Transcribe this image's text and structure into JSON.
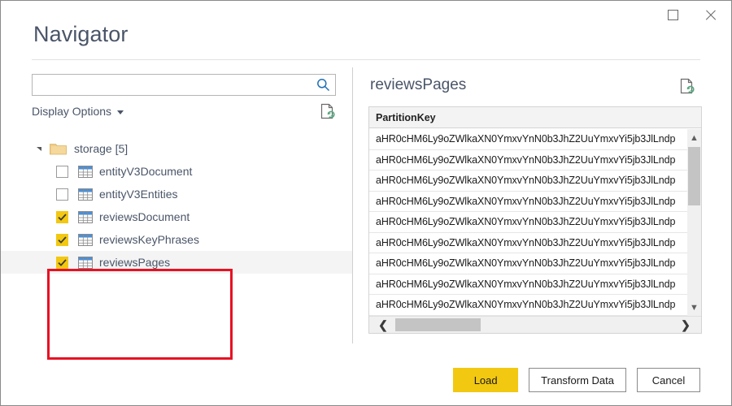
{
  "window": {
    "title": "Navigator",
    "maximize_label": "Maximize",
    "close_label": "Close"
  },
  "search": {
    "value": "",
    "placeholder": "",
    "icon": "search-icon"
  },
  "display_options": {
    "label": "Display Options",
    "caret_icon": "chevron-down-icon",
    "refresh_icon": "refresh-page-icon"
  },
  "tree": {
    "root": {
      "label": "storage [5]",
      "count": "[5]",
      "expanded": true,
      "folder_icon": "folder-icon",
      "expander_icon": "expander-triangle-icon"
    },
    "items": [
      {
        "label": "entityV3Document",
        "checked": false,
        "selected": false,
        "icon": "table-icon"
      },
      {
        "label": "entityV3Entities",
        "checked": false,
        "selected": false,
        "icon": "table-icon"
      },
      {
        "label": "reviewsDocument",
        "checked": true,
        "selected": false,
        "icon": "table-icon"
      },
      {
        "label": "reviewsKeyPhrases",
        "checked": true,
        "selected": false,
        "icon": "table-icon"
      },
      {
        "label": "reviewsPages",
        "checked": true,
        "selected": true,
        "icon": "table-icon"
      }
    ]
  },
  "highlight": {
    "color": "#e81123",
    "type": "annotation-rectangle"
  },
  "preview": {
    "title": "reviewsPages",
    "refresh_icon": "refresh-page-icon",
    "columns": [
      "PartitionKey"
    ],
    "rows": [
      [
        "aHR0cHM6Ly9oZWlkaXN0YmxvYnN0b3JhZ2UuYmxvYi5jb3JlLndp"
      ],
      [
        "aHR0cHM6Ly9oZWlkaXN0YmxvYnN0b3JhZ2UuYmxvYi5jb3JlLndp"
      ],
      [
        "aHR0cHM6Ly9oZWlkaXN0YmxvYnN0b3JhZ2UuYmxvYi5jb3JlLndp"
      ],
      [
        "aHR0cHM6Ly9oZWlkaXN0YmxvYnN0b3JhZ2UuYmxvYi5jb3JlLndp"
      ],
      [
        "aHR0cHM6Ly9oZWlkaXN0YmxvYnN0b3JhZ2UuYmxvYi5jb3JlLndp"
      ],
      [
        "aHR0cHM6Ly9oZWlkaXN0YmxvYnN0b3JhZ2UuYmxvYi5jb3JlLndp"
      ],
      [
        "aHR0cHM6Ly9oZWlkaXN0YmxvYnN0b3JhZ2UuYmxvYi5jb3JlLndp"
      ],
      [
        "aHR0cHM6Ly9oZWlkaXN0YmxvYnN0b3JhZ2UuYmxvYi5jb3JlLndp"
      ],
      [
        "aHR0cHM6Ly9oZWlkaXN0YmxvYnN0b3JhZ2UuYmxvYi5jb3JlLndp"
      ]
    ],
    "scroll": {
      "up_arrow": "▲",
      "down_arrow": "▼",
      "left_arrow": "❮",
      "right_arrow": "❯"
    }
  },
  "footer": {
    "load_label": "Load",
    "transform_label": "Transform Data",
    "cancel_label": "Cancel"
  },
  "colors": {
    "accent_yellow": "#f2c811",
    "highlight_red": "#e81123",
    "text": "#4a5568",
    "refresh_green": "#5aa67f"
  }
}
